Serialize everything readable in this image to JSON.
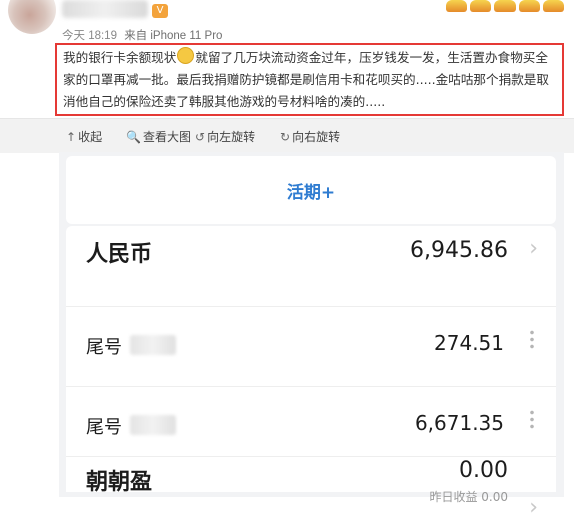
{
  "post": {
    "meta_time": "今天 18:19",
    "meta_source": "来自 iPhone 11 Pro",
    "text_a": "我的银行卡余额现状",
    "text_b": "就留了几万块流动资金过年，压岁钱发一发，生活置办食物买全家的口罩再减一批。最后我捐赠防护镜都是刷信用卡和花呗买的.....金咕咕那个捐款是取消他自己的保险还卖了韩服其他游戏的号材料啥的凑的....."
  },
  "actions": [
    {
      "icon": "↑",
      "label": "收起"
    },
    {
      "icon": "🔍",
      "label": "查看大图"
    },
    {
      "icon": "↺",
      "label": "向左旋转"
    },
    {
      "icon": "↻",
      "label": "向右旋转"
    }
  ],
  "bank": {
    "tab_label": "活期+",
    "currency_label": "人民币",
    "currency_total": "6,945.86",
    "accounts": [
      {
        "label": "尾号",
        "amount": "274.51"
      },
      {
        "label": "尾号",
        "amount": "6,671.35"
      }
    ],
    "zz_label": "朝朝盈",
    "zz_amount": "0.00",
    "zz_sub": "昨日收益 0.00"
  }
}
